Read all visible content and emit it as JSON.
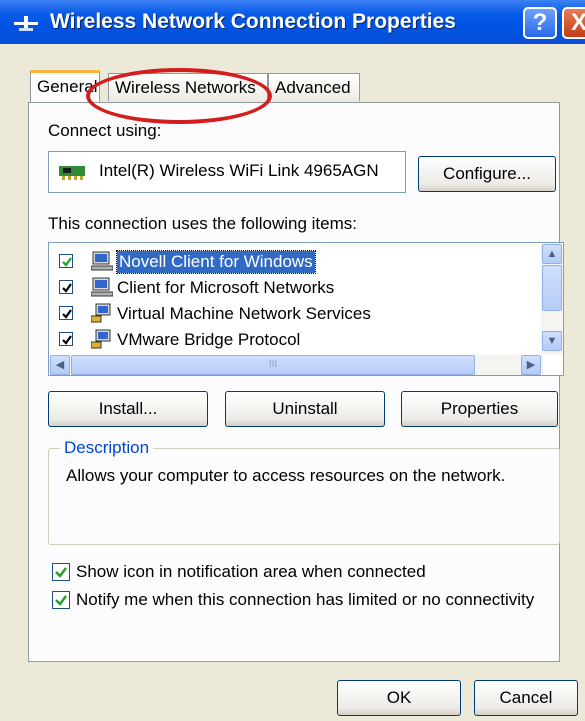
{
  "window": {
    "title": "Wireless Network Connection Properties",
    "help_symbol": "?",
    "close_symbol": "X"
  },
  "tabs": [
    {
      "label": "General",
      "active": true
    },
    {
      "label": "Wireless Networks",
      "active": false
    },
    {
      "label": "Advanced",
      "active": false
    }
  ],
  "general": {
    "connect_using_label": "Connect using:",
    "adapter_name": "Intel(R) Wireless WiFi Link 4965AGN",
    "configure_label": "Configure...",
    "items_label": "This connection uses the following items:",
    "items": [
      {
        "label": "Novell Client for Windows",
        "checked": true,
        "selected": true
      },
      {
        "label": "Client for Microsoft Networks",
        "checked": true,
        "selected": false
      },
      {
        "label": "Virtual Machine Network Services",
        "checked": true,
        "selected": false
      },
      {
        "label": "VMware Bridge Protocol",
        "checked": true,
        "selected": false
      }
    ],
    "install_label": "Install...",
    "uninstall_label": "Uninstall",
    "properties_label": "Properties",
    "description_title": "Description",
    "description_text": "Allows your computer to access resources on the network.",
    "show_icon_label": "Show icon in notification area when connected",
    "show_icon_checked": true,
    "notify_label": "Notify me when this connection has limited or no connectivity",
    "notify_checked": true
  },
  "footer": {
    "ok_label": "OK",
    "cancel_label": "Cancel"
  },
  "scroll": {
    "up_arrow": "▲",
    "down_arrow": "▼",
    "left_arrow": "◀",
    "right_arrow": "▶",
    "grip": "III"
  },
  "annotation": {
    "color": "#d41d1d"
  },
  "colors": {
    "titlebar": "#0054e3",
    "selection": "#316ac5",
    "tab_highlight": "#f7b53a"
  }
}
